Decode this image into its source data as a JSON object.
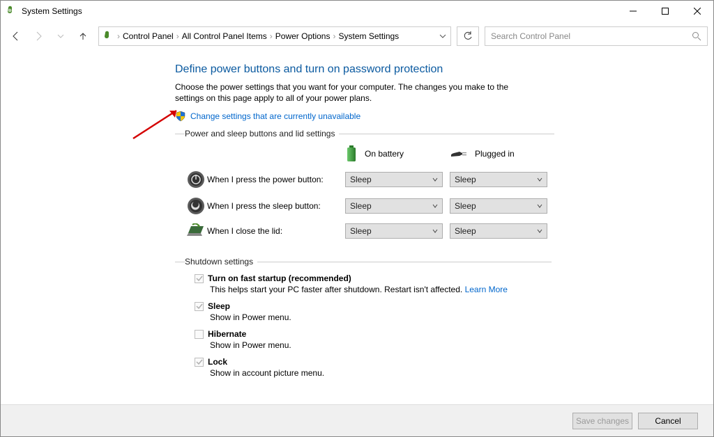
{
  "window": {
    "title": "System Settings"
  },
  "breadcrumbs": [
    "Control Panel",
    "All Control Panel Items",
    "Power Options",
    "System Settings"
  ],
  "search": {
    "placeholder": "Search Control Panel"
  },
  "page": {
    "heading": "Define power buttons and turn on password protection",
    "description": "Choose the power settings that you want for your computer. The changes you make to the settings on this page apply to all of your power plans.",
    "change_link": "Change settings that are currently unavailable"
  },
  "section1": {
    "legend": "Power and sleep buttons and lid settings",
    "col_battery": "On battery",
    "col_plugged": "Plugged in",
    "rows": [
      {
        "label": "When I press the power button:",
        "battery": "Sleep",
        "plugged": "Sleep"
      },
      {
        "label": "When I press the sleep button:",
        "battery": "Sleep",
        "plugged": "Sleep"
      },
      {
        "label": "When I close the lid:",
        "battery": "Sleep",
        "plugged": "Sleep"
      }
    ]
  },
  "section2": {
    "legend": "Shutdown settings",
    "items": [
      {
        "title": "Turn on fast startup (recommended)",
        "sub": "This helps start your PC faster after shutdown. Restart isn't affected.",
        "link": "Learn More",
        "checked": true
      },
      {
        "title": "Sleep",
        "sub": "Show in Power menu.",
        "checked": true
      },
      {
        "title": "Hibernate",
        "sub": "Show in Power menu.",
        "checked": false
      },
      {
        "title": "Lock",
        "sub": "Show in account picture menu.",
        "checked": true
      }
    ]
  },
  "footer": {
    "save": "Save changes",
    "cancel": "Cancel"
  }
}
